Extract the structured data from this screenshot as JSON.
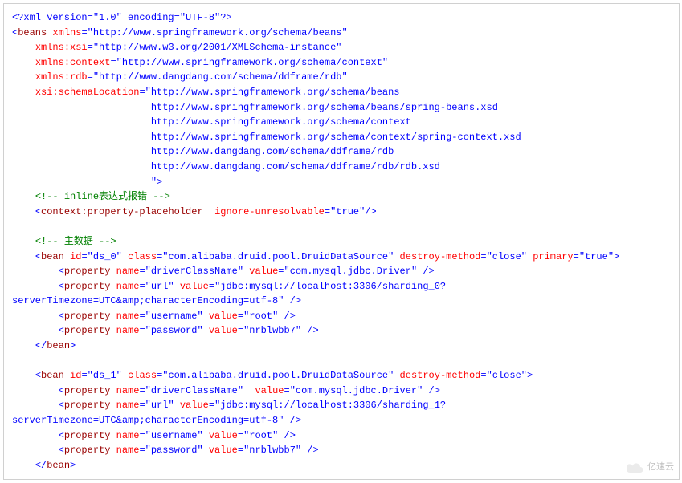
{
  "xml_decl": "<?xml version=\"1.0\" encoding=\"UTF-8\"?>",
  "beans_open": {
    "tag": "beans",
    "attrs": {
      "xmlns": "http://www.springframework.org/schema/beans",
      "xmlns:xsi": "http://www.w3.org/2001/XMLSchema-instance",
      "xmlns:context": "http://www.springframework.org/schema/context",
      "xmlns:rdb": "http://www.dangdang.com/schema/ddframe/rdb",
      "xsi:schemaLocation_first": "http://www.springframework.org/schema/beans",
      "schemaLocations": [
        "http://www.springframework.org/schema/beans/spring-beans.xsd",
        "http://www.springframework.org/schema/context",
        "http://www.springframework.org/schema/context/spring-context.xsd",
        "http://www.dangdang.com/schema/ddframe/rdb",
        "http://www.dangdang.com/schema/ddframe/rdb/rdb.xsd"
      ]
    }
  },
  "comment_inline": "<!-- inline表达式报错 -->",
  "context_placeholder": {
    "tag": "context:property-placeholder",
    "attr_name": "ignore-unresolvable",
    "attr_val": "true"
  },
  "comment_main": "<!-- 主数据 -->",
  "bean0": {
    "id": "ds_0",
    "class": "com.alibaba.druid.pool.DruidDataSource",
    "destroy_method": "close",
    "primary": "true",
    "props": [
      {
        "name": "driverClassName",
        "value": "com.mysql.jdbc.Driver"
      },
      {
        "name": "url",
        "value_part1": "jdbc:mysql://localhost:3306/sharding_0?",
        "value_part2": "serverTimezone=UTC&amp;characterEncoding=utf-8"
      },
      {
        "name": "username",
        "value": "root"
      },
      {
        "name": "password",
        "value": "nrblwbb7"
      }
    ]
  },
  "bean1": {
    "id": "ds_1",
    "class": "com.alibaba.druid.pool.DruidDataSource",
    "destroy_method": "close",
    "props": [
      {
        "name": "driverClassName",
        "value": "com.mysql.jdbc.Driver"
      },
      {
        "name": "url",
        "value_part1": "jdbc:mysql://localhost:3306/sharding_1?",
        "value_part2": "serverTimezone=UTC&amp;characterEncoding=utf-8"
      },
      {
        "name": "username",
        "value": "root"
      },
      {
        "name": "password",
        "value": "nrblwbb7"
      }
    ]
  },
  "close_bean": "</bean>",
  "watermark": "亿速云"
}
